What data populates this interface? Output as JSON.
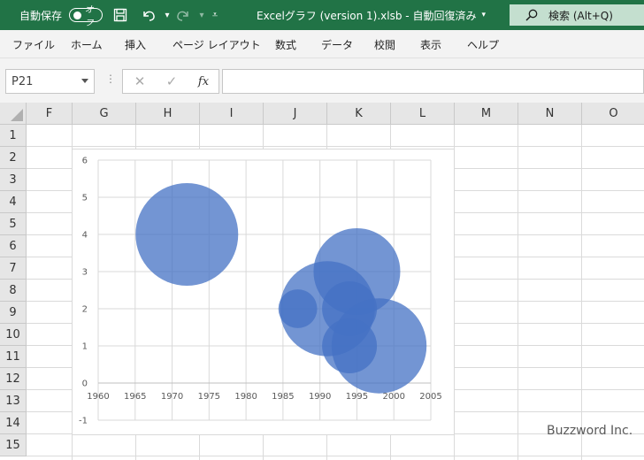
{
  "titlebar": {
    "autosave_label": "自動保存",
    "autosave_state": "オフ",
    "file_title": "Excelグラフ (version 1).xlsb  -  自動回復済み",
    "search_label": "検索 (Alt+Q)",
    "bg_color": "#217346"
  },
  "menu": {
    "items": [
      "ファイル",
      "ホーム",
      "挿入",
      "ページ レイアウト",
      "数式",
      "データ",
      "校閲",
      "表示",
      "ヘルプ"
    ]
  },
  "formula": {
    "name_box": "P21",
    "cancel": "✕",
    "enter": "✓",
    "fx": "fx",
    "value": ""
  },
  "grid": {
    "columns": [
      "F",
      "G",
      "H",
      "I",
      "J",
      "K",
      "L",
      "M",
      "N",
      "O"
    ],
    "rows": [
      "1",
      "2",
      "3",
      "4",
      "5",
      "6",
      "7",
      "8",
      "9",
      "10",
      "11",
      "12",
      "13",
      "14",
      "15"
    ]
  },
  "chart_data": {
    "type": "scatter",
    "subtype": "bubble",
    "title": "",
    "xlabel": "",
    "ylabel": "",
    "xlim": [
      1960,
      2005
    ],
    "ylim": [
      -1,
      6
    ],
    "x_ticks": [
      "1960",
      "1965",
      "1970",
      "1975",
      "1980",
      "1985",
      "1990",
      "1995",
      "2000",
      "2005"
    ],
    "y_ticks": [
      "6",
      "5",
      "4",
      "3",
      "2",
      "1",
      "0",
      "-1"
    ],
    "grid": true,
    "legend": "none",
    "bubble_color": "#4472c4",
    "series": [
      {
        "points": [
          {
            "x": 1972,
            "y": 4,
            "size": 70
          },
          {
            "x": 1995,
            "y": 3,
            "size": 50
          },
          {
            "x": 1987,
            "y": 2,
            "size": 10
          },
          {
            "x": 1991,
            "y": 2,
            "size": 60
          },
          {
            "x": 1994,
            "y": 2,
            "size": 20
          },
          {
            "x": 1998,
            "y": 1,
            "size": 60
          },
          {
            "x": 1994,
            "y": 1,
            "size": 20
          }
        ]
      }
    ]
  },
  "watermark": "Buzzword Inc."
}
